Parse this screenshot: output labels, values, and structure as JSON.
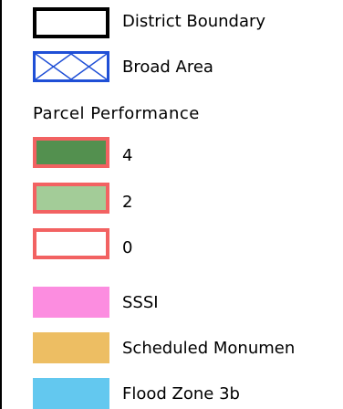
{
  "legend": {
    "district_boundary": {
      "label": "District Boundary",
      "border_color": "#000000",
      "fill": "#ffffff"
    },
    "broad_area": {
      "label": "Broad Area",
      "border_color": "#1f4fd6",
      "fill": "#ffffff"
    },
    "parcel_performance": {
      "title": "Parcel Performance",
      "items": [
        {
          "label": "4",
          "border_color": "#f26262",
          "fill": "#53904f"
        },
        {
          "label": "2",
          "border_color": "#f26262",
          "fill": "#a3cc98"
        },
        {
          "label": "0",
          "border_color": "#f26262",
          "fill": "#ffffff"
        }
      ]
    },
    "designations": [
      {
        "label": "SSSI",
        "fill": "#fc8de0"
      },
      {
        "label": "Scheduled Monumen",
        "fill": "#edbe63"
      },
      {
        "label": "Flood Zone 3b",
        "fill": "#63c8ef"
      }
    ]
  }
}
